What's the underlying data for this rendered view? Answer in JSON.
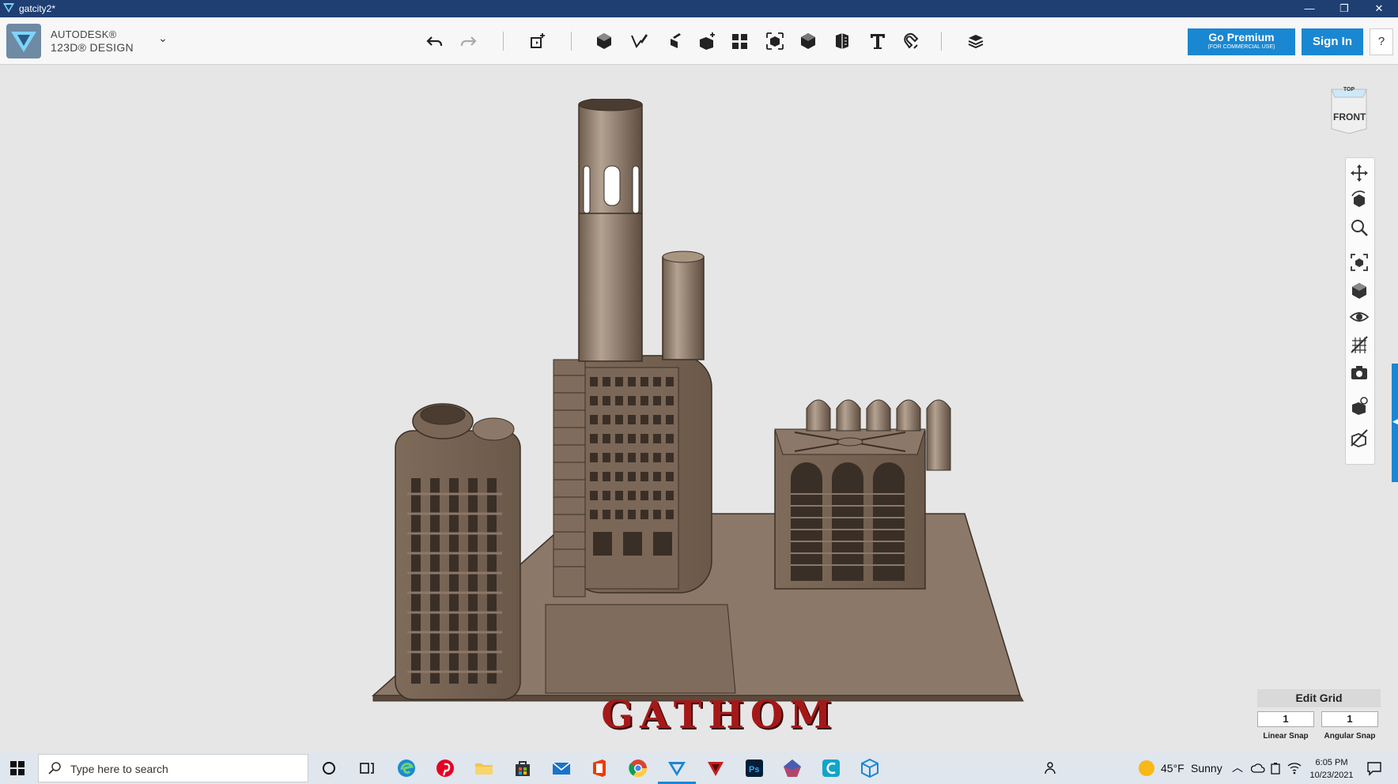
{
  "window": {
    "title": "gatcity2*",
    "minimize": "—",
    "restore": "❐",
    "close": "✕"
  },
  "brand": {
    "line1": "AUTODESK®",
    "line2": "123D® DESIGN",
    "chevron": "⌄"
  },
  "toolbar": {
    "tools": [
      "undo",
      "redo",
      "transform",
      "primitives",
      "sketch",
      "construct",
      "modify",
      "pattern",
      "grouping",
      "combine",
      "measure",
      "text",
      "snap",
      "material"
    ],
    "premium": {
      "label": "Go Premium",
      "sub": "(FOR COMMERCIAL USE)"
    },
    "signin": "Sign In",
    "help": "?"
  },
  "viewcube": {
    "top": "TOP",
    "front": "FRONT"
  },
  "navigation": [
    "pan",
    "orbit",
    "zoom",
    "fit",
    "views",
    "visibility",
    "materials-toggle",
    "screenshot",
    "select-bodies",
    "outline-toggle"
  ],
  "scene": {
    "label_3d": "GATHOM"
  },
  "edit_grid": {
    "header": "Edit Grid",
    "linear_snap_value": "1",
    "angular_snap_value": "1",
    "linear_snap_label": "Linear Snap",
    "angular_snap_label": "Angular Snap"
  },
  "taskbar": {
    "search_placeholder": "Type here to search",
    "apps": [
      "cortana",
      "task-view",
      "edge",
      "pinterest",
      "file-explorer",
      "store",
      "mail",
      "office",
      "chrome",
      "123d-design",
      "app-red",
      "photoshop",
      "app-gem",
      "app-c",
      "app-cube"
    ],
    "weather": {
      "temp": "45°F",
      "condition": "Sunny"
    },
    "time": "6:05 PM",
    "date": "10/23/2021"
  },
  "colors": {
    "titlebar": "#1f3f73",
    "accent": "#1a87d2",
    "model": "#8a7563",
    "label_red": "#a51818"
  }
}
